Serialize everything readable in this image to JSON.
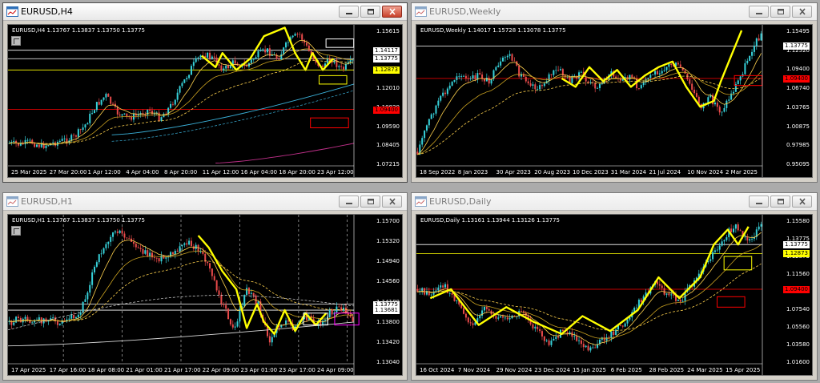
{
  "windows": [
    {
      "id": "h4",
      "title": "EURUSD,H4",
      "active": true,
      "info": "EURUSD,H4  1.13767 1.13837 1.13750 1.13775",
      "prices": [
        "1.15615",
        "1.14425",
        "1.13200",
        "1.12010",
        "1.10820",
        "1.09590",
        "1.08405",
        "1.07215"
      ],
      "tags": [
        {
          "text": "1.14117",
          "bg": "#ffffff",
          "fg": "#000000"
        },
        {
          "text": "1.13775",
          "bg": "#ffffff",
          "fg": "#000000"
        },
        {
          "text": "1.12873",
          "bg": "#ffff00",
          "fg": "#000000"
        },
        {
          "text": "1.09400",
          "bg": "#ff0000",
          "fg": "#000000"
        }
      ],
      "dates": [
        "25 Mar 2025",
        "27 Mar 20:00",
        "1 Apr 12:00",
        "4 Apr 04:00",
        "8 Apr 20:00",
        "11 Apr 12:00",
        "16 Apr 04:00",
        "18 Apr 20:00",
        "23 Apr 12:00"
      ]
    },
    {
      "id": "weekly",
      "title": "EURUSD,Weekly",
      "active": false,
      "info": "EURUSD,Weekly  1.14017 1.15728 1.13078 1.13775",
      "prices": [
        "1.15495",
        "1.12520",
        "1.09400",
        "1.06740",
        "1.03765",
        "1.00875",
        "0.97985",
        "0.95095"
      ],
      "tags": [
        {
          "text": "1.13775",
          "bg": "#ffffff",
          "fg": "#000000"
        },
        {
          "text": "1.09400",
          "bg": "#ff0000",
          "fg": "#000000"
        }
      ],
      "dates": [
        "18 Sep 2022",
        "8 Jan 2023",
        "30 Apr 2023",
        "20 Aug 2023",
        "10 Dec 2023",
        "31 Mar 2024",
        "21 Jul 2024",
        "10 Nov 2024",
        "2 Mar 2025"
      ]
    },
    {
      "id": "h1",
      "title": "EURUSD,H1",
      "active": false,
      "info": "EURUSD,H1  1.13767 1.13837 1.13750 1.13775",
      "prices": [
        "1.15700",
        "1.15320",
        "1.14940",
        "1.14560",
        "1.14180",
        "1.13800",
        "1.13420",
        "1.13040"
      ],
      "tags": [
        {
          "text": "1.13775",
          "bg": "#ffffff",
          "fg": "#000000"
        },
        {
          "text": "1.13681",
          "bg": "#ffffff",
          "fg": "#000000"
        }
      ],
      "dates": [
        "17 Apr 2025",
        "17 Apr 16:00",
        "18 Apr 08:00",
        "21 Apr 01:00",
        "21 Apr 17:00",
        "22 Apr 09:00",
        "23 Apr 01:00",
        "23 Apr 17:00",
        "24 Apr 09:00"
      ]
    },
    {
      "id": "daily",
      "title": "EURUSD,Daily",
      "active": false,
      "info": "EURUSD,Daily  1.13161 1.13944 1.13126 1.13775",
      "prices": [
        "1.15580",
        "1.13775",
        "1.12873",
        "1.11560",
        "1.09400",
        "1.07540",
        "1.05560",
        "1.03580",
        "1.01600"
      ],
      "tags": [
        {
          "text": "1.13775",
          "bg": "#ffffff",
          "fg": "#000000"
        },
        {
          "text": "1.12873",
          "bg": "#ffff00",
          "fg": "#000000"
        },
        {
          "text": "1.09400",
          "bg": "#ff0000",
          "fg": "#000000"
        }
      ],
      "dates": [
        "16 Oct 2024",
        "7 Nov 2024",
        "29 Nov 2024",
        "23 Dec 2024",
        "15 Jan 2025",
        "6 Feb 2025",
        "28 Feb 2025",
        "24 Mar 2025",
        "15 Apr 2025"
      ]
    }
  ]
}
